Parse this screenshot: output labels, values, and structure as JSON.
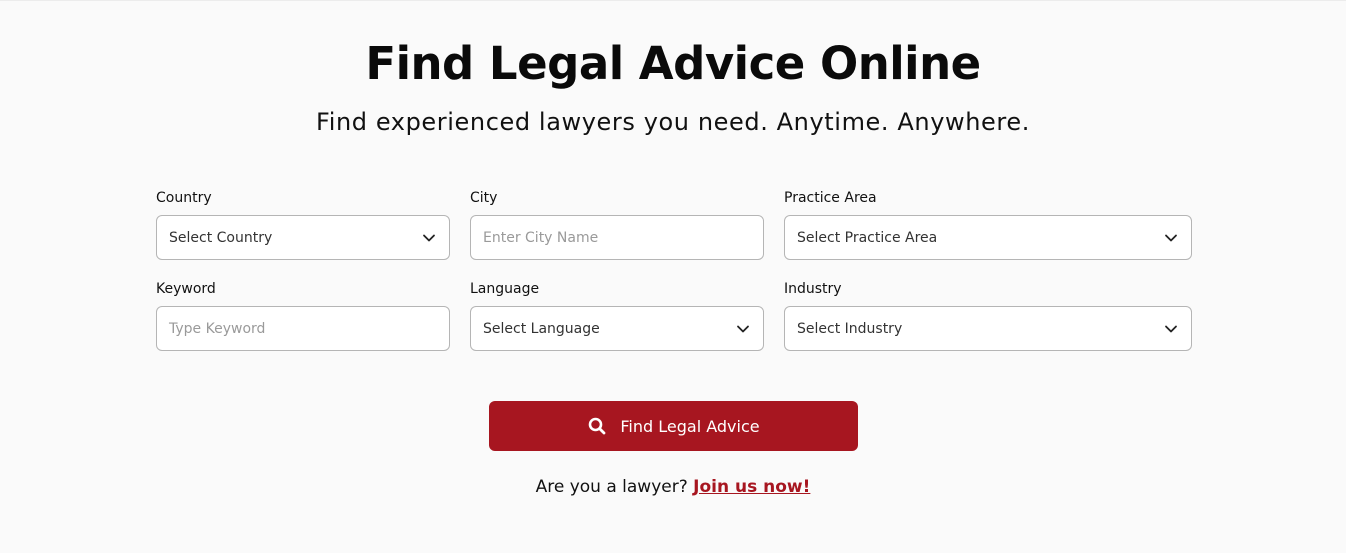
{
  "header": {
    "title": "Find Legal Advice Online",
    "subtitle": "Find experienced lawyers you need. Anytime. Anywhere."
  },
  "form": {
    "country": {
      "label": "Country",
      "value": "Select Country",
      "icon": "chevron-down-icon"
    },
    "city": {
      "label": "City",
      "placeholder": "Enter City Name"
    },
    "practice_area": {
      "label": "Practice Area",
      "value": "Select Practice Area",
      "icon": "chevron-down-icon"
    },
    "keyword": {
      "label": "Keyword",
      "placeholder": "Type Keyword"
    },
    "language": {
      "label": "Language",
      "value": "Select Language",
      "icon": "chevron-down-icon"
    },
    "industry": {
      "label": "Industry",
      "value": "Select Industry",
      "icon": "chevron-down-icon"
    }
  },
  "search_button": {
    "label": "Find Legal Advice",
    "icon": "search-icon",
    "color": "#a71620"
  },
  "join": {
    "prompt": "Are you a lawyer?",
    "link": "Join us now!"
  },
  "colors": {
    "accent": "#a71620",
    "background": "#fafafa",
    "field_border": "#b5b5b5"
  }
}
